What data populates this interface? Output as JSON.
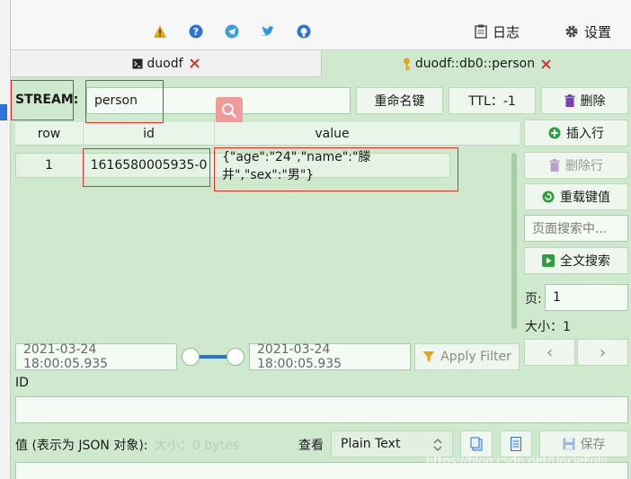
{
  "toolbar": {
    "log_label": "日志",
    "settings_label": "设置"
  },
  "tabs": [
    {
      "label": "duodf"
    },
    {
      "label": "duodf::db0::person"
    }
  ],
  "key": {
    "type_label": "STREAM:",
    "name": "person",
    "rename_label": "重命名键",
    "ttl_label": "TTL：-1",
    "delete_label": "删除"
  },
  "table": {
    "headers": [
      "row",
      "id",
      "value"
    ],
    "rows": [
      {
        "row": "1",
        "id": "1616580005935-0",
        "value": "{\"age\":\"24\",\"name\":\"滕井\",\"sex\":\"男\"}"
      }
    ]
  },
  "actions": {
    "insert_row": "插入行",
    "delete_row": "删除行",
    "reload": "重载键值",
    "search_placeholder": "页面搜索中...",
    "fulltext": "全文搜索",
    "page_label": "页:",
    "page_value": "1",
    "size_label": "大小：1",
    "prev": "‹",
    "next": "›"
  },
  "filter": {
    "start": "2021-03-24 18:00:05.935",
    "end": "2021-03-24 18:00:05.935",
    "apply_label": "Apply Filter"
  },
  "detail": {
    "id_label": "ID",
    "value_label": "值 (表示为 JSON 对象):",
    "size_hint": "大小：0 bytes",
    "view_label": "查看",
    "format": "Plain Text",
    "save_label": "保存"
  },
  "watermark": "https://blog.csdn.net/UncleFujii",
  "colors": {
    "panel": "#cfe9cf",
    "accent_blue": "#2b73d6",
    "highlight": "#e03030"
  }
}
